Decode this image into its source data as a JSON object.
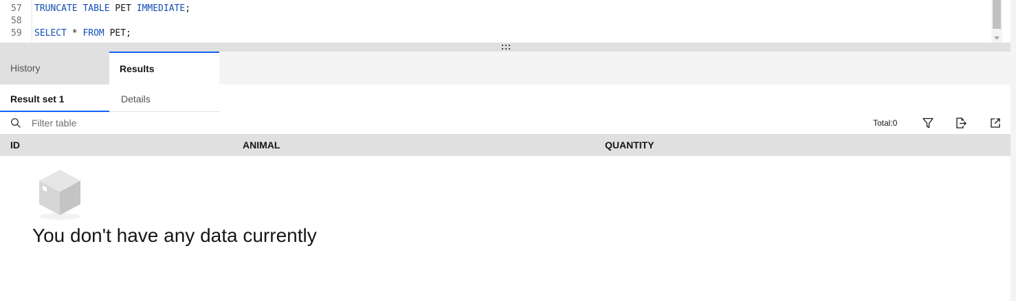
{
  "editor": {
    "lines": [
      {
        "number": "57",
        "tokens": [
          {
            "text": "TRUNCATE",
            "kw": true
          },
          {
            "text": " ",
            "kw": false
          },
          {
            "text": "TABLE",
            "kw": true
          },
          {
            "text": " PET ",
            "kw": false
          },
          {
            "text": "IMMEDIATE",
            "kw": true
          },
          {
            "text": ";",
            "kw": false
          }
        ]
      },
      {
        "number": "58",
        "tokens": []
      },
      {
        "number": "59",
        "tokens": [
          {
            "text": "SELECT",
            "kw": true
          },
          {
            "text": " * ",
            "kw": false
          },
          {
            "text": "FROM",
            "kw": true
          },
          {
            "text": " PET;",
            "kw": false
          }
        ]
      }
    ]
  },
  "tabs": {
    "history": "History",
    "results": "Results",
    "active": "results"
  },
  "subtabs": {
    "result_set": "Result set 1",
    "details": "Details",
    "active": "result_set"
  },
  "toolbar": {
    "filter_placeholder": "Filter table",
    "total": "Total:0",
    "icons": [
      "search-icon",
      "filter-icon",
      "export-icon",
      "launch-icon"
    ]
  },
  "table": {
    "columns": [
      "ID",
      "ANIMAL",
      "QUANTITY"
    ],
    "rows": []
  },
  "empty_state": {
    "message": "You don't have any data currently",
    "icon": "empty-box-icon"
  },
  "colors": {
    "accent": "#0f62fe",
    "keyword": "#0f4fb8",
    "header_bg": "#e0e0e0",
    "tab_bg": "#f4f4f4"
  }
}
